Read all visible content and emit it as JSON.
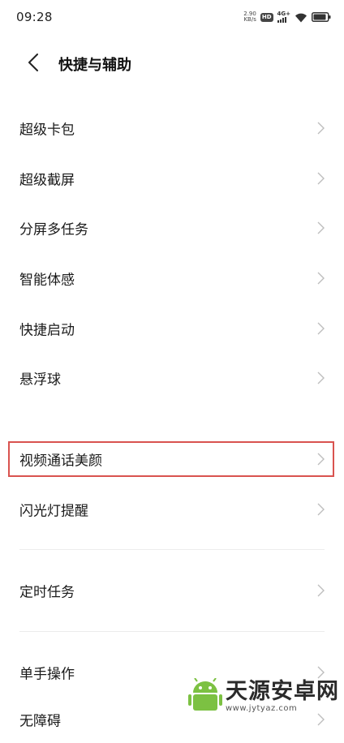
{
  "status_bar": {
    "time": "09:28",
    "net_speed_value": "2.90",
    "net_speed_unit": "KB/s",
    "hd_label": "HD",
    "network_label": "4G+",
    "icons": [
      "hd-icon",
      "signal-icon",
      "wifi-icon",
      "battery-icon"
    ]
  },
  "header": {
    "back_icon": "chevron-left-icon",
    "title": "快捷与辅助"
  },
  "groups": [
    {
      "items": [
        {
          "label": "超级卡包",
          "chevron": "chevron-right-icon"
        },
        {
          "label": "超级截屏",
          "chevron": "chevron-right-icon"
        },
        {
          "label": "分屏多任务",
          "chevron": "chevron-right-icon"
        },
        {
          "label": "智能体感",
          "chevron": "chevron-right-icon"
        },
        {
          "label": "快捷启动",
          "chevron": "chevron-right-icon"
        },
        {
          "label": "悬浮球",
          "chevron": "chevron-right-icon"
        }
      ]
    },
    {
      "items": [
        {
          "label": "视频通话美颜",
          "chevron": "chevron-right-icon",
          "highlighted": true
        },
        {
          "label": "闪光灯提醒",
          "chevron": "chevron-right-icon"
        }
      ]
    },
    {
      "items": [
        {
          "label": "定时任务",
          "chevron": "chevron-right-icon"
        }
      ]
    },
    {
      "items": [
        {
          "label": "单手操作",
          "chevron": "chevron-right-icon"
        },
        {
          "label": "无障碍",
          "chevron": "chevron-right-icon"
        }
      ]
    }
  ],
  "highlight_color": "#d9534f",
  "watermark": {
    "brand": "天源安卓网",
    "url": "www.jytyaz.com",
    "logo_icon": "android-logo-icon",
    "logo_color": "#7cc142"
  }
}
